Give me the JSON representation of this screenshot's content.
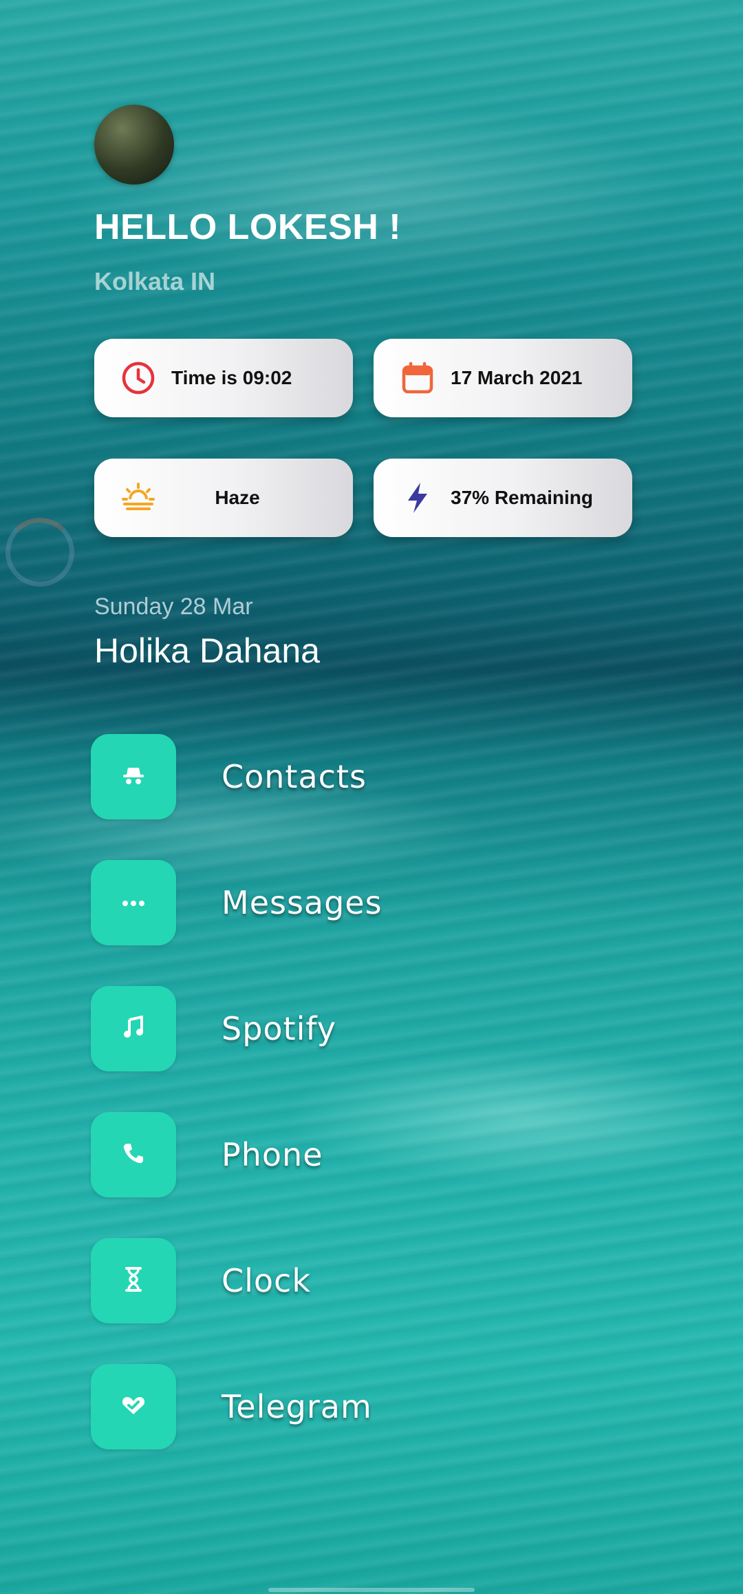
{
  "greeting": "HELLO LOKESH !",
  "location": "Kolkata IN",
  "cards": {
    "time": {
      "text": "Time is 09:02",
      "icon": "clock-icon",
      "color": "#e8323c"
    },
    "date": {
      "text": "17 March 2021",
      "icon": "calendar-icon",
      "color": "#f0663a"
    },
    "weather": {
      "text": "Haze",
      "icon": "haze-icon",
      "color": "#f5a623"
    },
    "battery": {
      "text": "37% Remaining",
      "icon": "lightning-icon",
      "color": "#3b3aa0"
    }
  },
  "event": {
    "date": "Sunday 28 Mar",
    "title": "Holika Dahana"
  },
  "apps": [
    {
      "label": "Contacts",
      "icon": "incognito-icon"
    },
    {
      "label": "Messages",
      "icon": "more-dots-icon"
    },
    {
      "label": "Spotify",
      "icon": "music-note-icon"
    },
    {
      "label": "Phone",
      "icon": "phone-icon"
    },
    {
      "label": "Clock",
      "icon": "hourglass-icon"
    },
    {
      "label": "Telegram",
      "icon": "heart-check-icon"
    }
  ],
  "colors": {
    "tile": "#24d6b4",
    "water_dark": "#0b4f60",
    "water_light": "#24b7ae"
  }
}
